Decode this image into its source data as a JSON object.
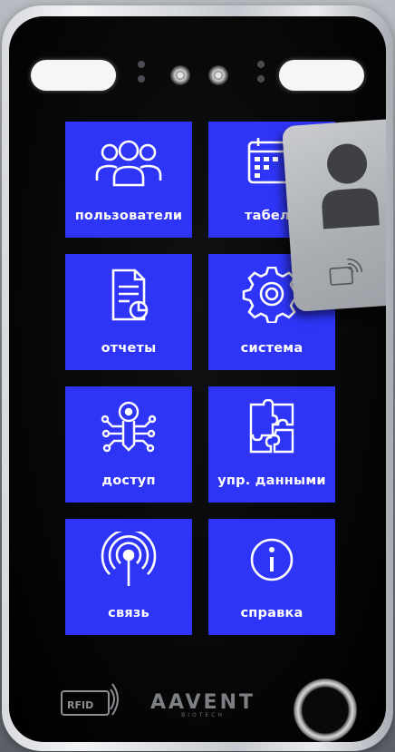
{
  "menu": {
    "users": "пользователи",
    "timesheet": "табель",
    "reports": "отчеты",
    "system": "система",
    "access": "доступ",
    "data_management": "упр. данными",
    "connection": "связь",
    "help": "справка"
  },
  "rfid_label": "RFID",
  "brand": {
    "name": "AAVENT",
    "sub": "BIOTECH"
  },
  "colors": {
    "tile": "#2f35f6",
    "bezel": "#000000",
    "card": "#b0b3b8"
  },
  "icons": [
    "users-icon",
    "calendar-icon",
    "report-icon",
    "gear-icon",
    "access-icon",
    "puzzle-icon",
    "signal-icon",
    "info-icon",
    "person-icon",
    "rfid-icon",
    "fingerprint-scanner"
  ]
}
